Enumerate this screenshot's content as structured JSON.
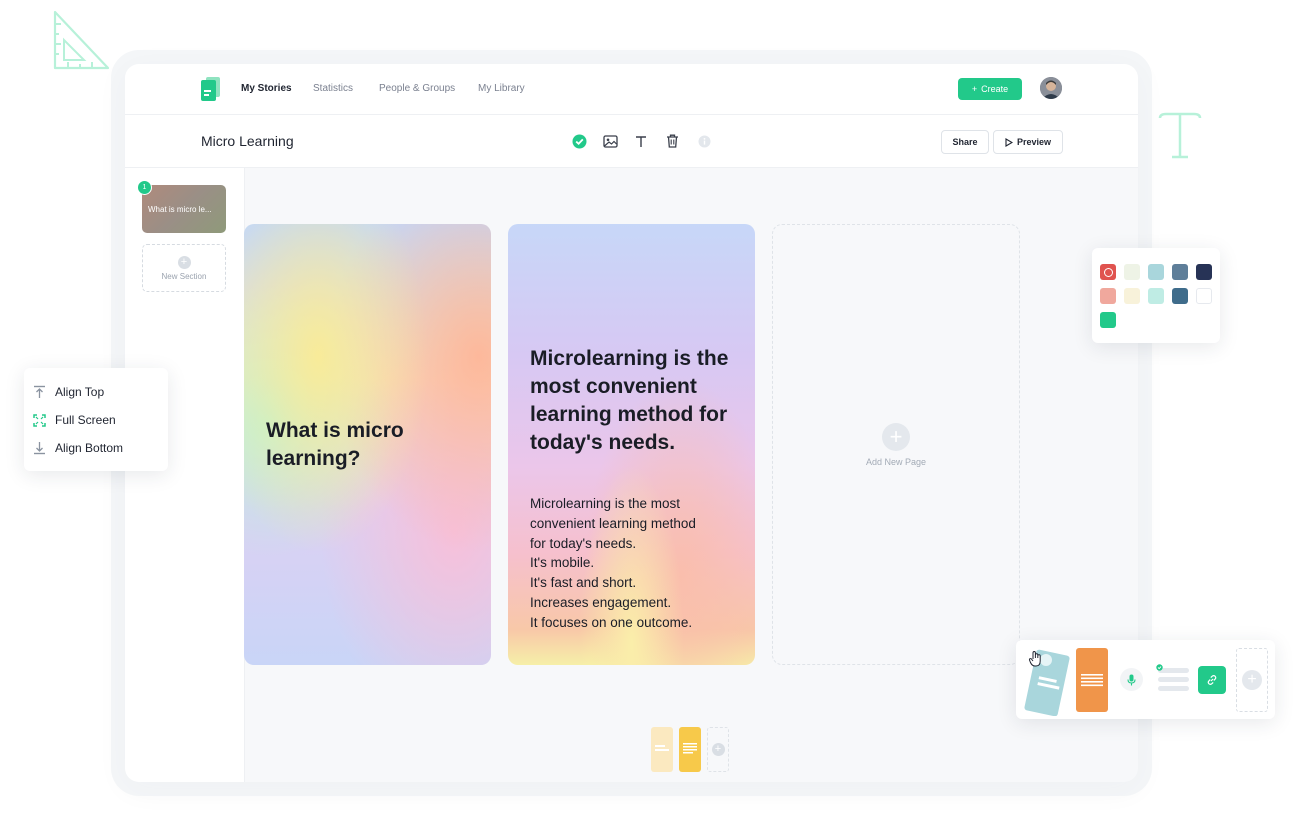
{
  "nav": {
    "items": [
      "My Stories",
      "Statistics",
      "People & Groups",
      "My Library"
    ],
    "create_label": "Create"
  },
  "toolbar": {
    "title": "Micro Learning",
    "share_label": "Share",
    "preview_label": "Preview"
  },
  "sidebar": {
    "sections": [
      {
        "number": "1",
        "label": "What is micro le..."
      }
    ],
    "new_section_label": "New Section"
  },
  "pages": [
    {
      "title": "What is micro learning?"
    },
    {
      "title": "Microlearning is the most convenient learning method for today's needs.",
      "body": [
        "Microlearning is the most",
        "convenient learning method",
        "for today's needs.",
        "It's mobile.",
        "It's fast and short.",
        "Increases engagement.",
        "It focuses on one outcome."
      ]
    }
  ],
  "add_page_label": "Add New Page",
  "align_menu": {
    "items": [
      "Align Top",
      "Full Screen",
      "Align Bottom"
    ]
  },
  "palette": {
    "colors": [
      "#e0534f",
      "#eef3e6",
      "#a9d6dc",
      "#5e7e99",
      "#273356",
      "#f0a89d",
      "#f8f2da",
      "#bfece4",
      "#3f6c8b",
      "#ffffff",
      "#22c98a"
    ]
  },
  "colors": {
    "accent": "#22c98a",
    "orange": "#f0954a",
    "yellow": "#f7c94a",
    "teal_light": "#a9d6dc"
  }
}
